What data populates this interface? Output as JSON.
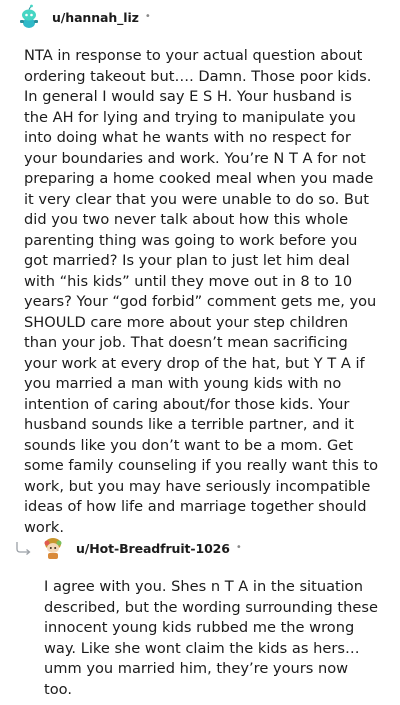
{
  "comments": [
    {
      "username": "u/hannah_liz",
      "separator": "•",
      "avatar_icon": "snoo-avatar-icon",
      "body": "NTA in response to your actual question about ordering takeout but…. Damn. Those poor kids. In general I would say E S H. Your husband is the AH for lying and trying to manipulate you into doing what he wants with no respect for your boundaries and work. You’re N T A for not preparing a home cooked meal when you made it very clear that you were unable to do so. But did you two never talk about how this whole parenting thing was going to work before you got married? Is your plan to just let him deal with “his kids” until they move out in 8 to 10 years? Your “god forbid” comment gets me, you SHOULD care more about your step children than your job. That doesn’t mean sacrificing your work at every drop of the hat, but Y T A if you married a man with young kids with no intention of caring about/for those kids. Your husband sounds like a terrible partner, and it sounds like you don’t want to be a mom. Get some family counseling if you really want this to work, but you may have seriously incompatible ideas of how life and marriage together should work."
    },
    {
      "username": "u/Hot-Breadfruit-1026",
      "separator": "•",
      "avatar_icon": "snoo-avatar-icon",
      "reply_icon": "reply-arrow-icon",
      "body": "I agree with you. Shes n T A in the situation described, but the wording surrounding these innocent young kids rubbed me the wrong way. Like she wont claim the kids as hers… umm you married him, they’re yours now too."
    }
  ],
  "colors": {
    "text": "#1c1c1c",
    "meta": "#8a8a8a",
    "avatar1_bg": "#46d6c4",
    "avatar2_hair": "#c9962e"
  }
}
